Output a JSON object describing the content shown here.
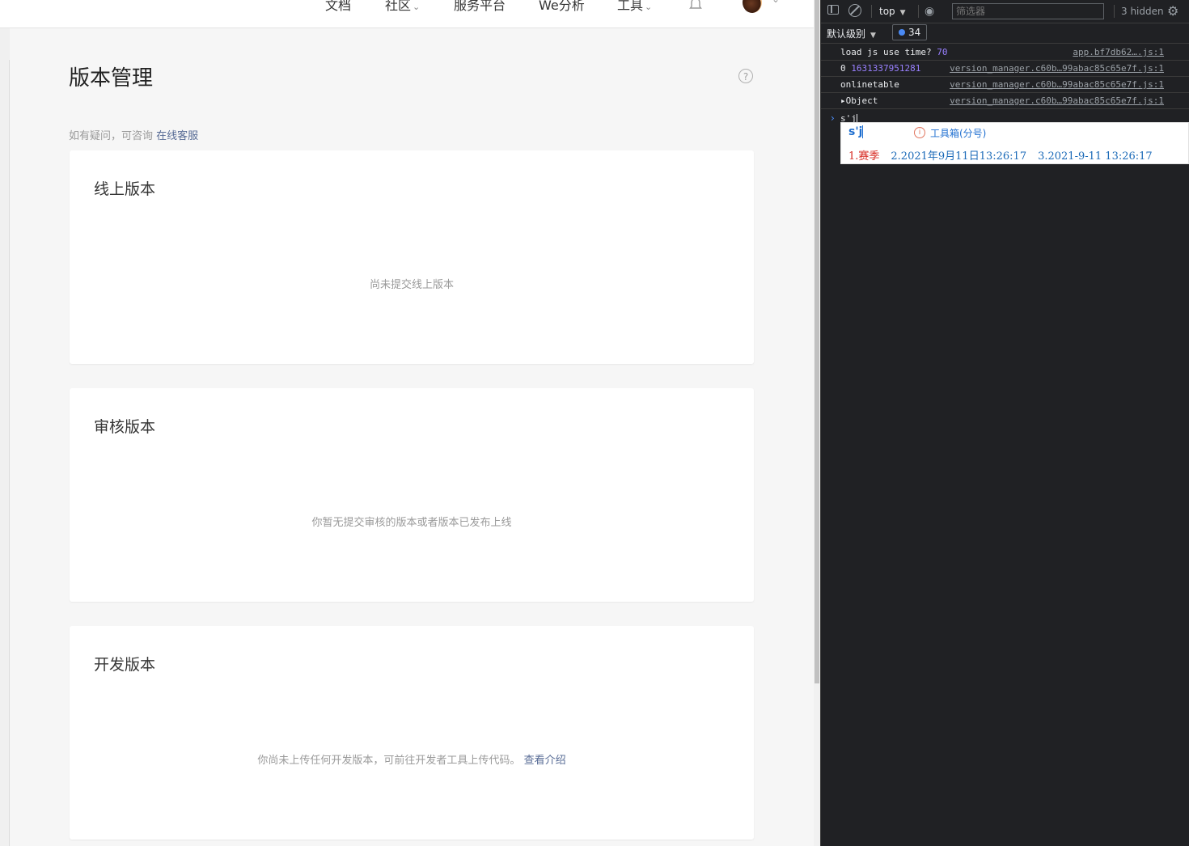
{
  "nav": {
    "items": [
      "文档",
      "社区",
      "服务平台",
      "We分析",
      "工具"
    ],
    "community_has_menu": true,
    "tools_has_menu": true
  },
  "page": {
    "title": "版本管理",
    "consult_prefix": "如有疑问，可咨询",
    "consult_link": "在线客服"
  },
  "cards": [
    {
      "title": "线上版本",
      "empty_text": "尚未提交线上版本"
    },
    {
      "title": "审核版本",
      "empty_text": "你暂无提交审核的版本或者版本已发布上线"
    },
    {
      "title": "开发版本",
      "empty_text": "你尚未上传任何开发版本，可前往开发者工具上传代码。",
      "link": "查看介绍"
    }
  ],
  "devtools": {
    "context": "top",
    "filter_placeholder": "筛选器",
    "hidden": "3 hidden",
    "levels": "默认级别",
    "issues_count": "34",
    "logs": [
      {
        "label": "load js use time?",
        "value": "70",
        "source": "app.bf7db62….js:1"
      },
      {
        "label": "0",
        "value": "1631337951281",
        "source": "version_manager.c60b…99abac85c65e7f.js:1"
      },
      {
        "label": "onlinetable",
        "value": "",
        "source": "version_manager.c60b…99abac85c65e7f.js:1"
      },
      {
        "label": "▸Object",
        "value": "",
        "source": "version_manager.c60b…99abac85c65e7f.js:1"
      }
    ],
    "console_input": "s'j"
  },
  "ime": {
    "composition": "s'j",
    "tip": "工具箱(分号)",
    "candidates": [
      "1.赛季",
      "2.2021年9月11日13:26:17",
      "3.2021-9-11 13:26:17"
    ]
  }
}
